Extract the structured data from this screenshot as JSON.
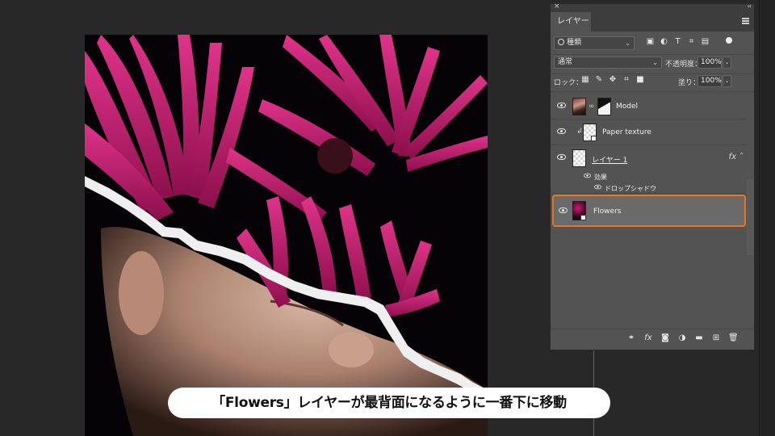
{
  "panel": {
    "close_glyph": "×",
    "collapse_glyph": "‹‹",
    "tab_label": "レイヤー",
    "filter": {
      "label": "種類",
      "icons": [
        "image-filter-icon",
        "adjustment-filter-icon",
        "type-filter-icon",
        "shape-filter-icon",
        "smart-object-filter-icon"
      ]
    },
    "blend_mode": "通常",
    "opacity_label": "不透明度：",
    "opacity_value": "100%",
    "lock_label": "ロック：",
    "lock_icons": [
      "lock-transparency-icon",
      "lock-paint-icon",
      "lock-position-icon",
      "lock-artboard-icon",
      "lock-all-icon"
    ],
    "fill_label": "塗り：",
    "fill_value": "100%",
    "layers": [
      {
        "name": "Model",
        "visible": true,
        "has_mask": true
      },
      {
        "name": "Paper texture",
        "visible": true,
        "clipped": true
      },
      {
        "name": "レイヤー 1",
        "visible": true,
        "has_fx": true,
        "effects_label": "効果",
        "effect_item": "ドロップシャドウ"
      },
      {
        "name": "Flowers",
        "visible": true,
        "selected": true
      }
    ],
    "fx_glyph": "fx",
    "bottom_icons": [
      "link-layers-icon",
      "add-style-icon",
      "add-mask-icon",
      "adjustment-layer-icon",
      "new-group-icon",
      "new-layer-icon",
      "delete-layer-icon"
    ]
  },
  "caption": "「Flowers」レイヤーが最背面になるように一番下に移動",
  "colors": {
    "highlight": "#e8761e",
    "flower": "#c81e74",
    "panel": "#535353"
  }
}
